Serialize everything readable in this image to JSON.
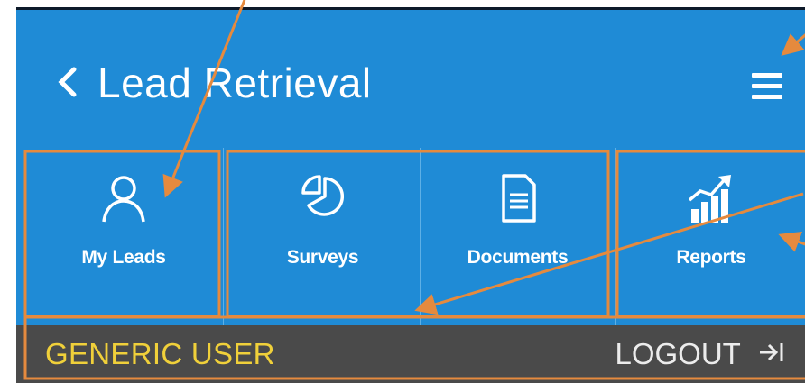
{
  "header": {
    "title": "Lead Retrieval",
    "back_icon": "chevron-left-icon",
    "menu_icon": "hamburger-menu-icon"
  },
  "nav": {
    "items": [
      {
        "label": "My Leads",
        "icon": "person-icon"
      },
      {
        "label": "Surveys",
        "icon": "pie-chart-icon"
      },
      {
        "label": "Documents",
        "icon": "document-icon"
      },
      {
        "label": "Reports",
        "icon": "bar-chart-growth-icon"
      }
    ]
  },
  "status_bar": {
    "user": "GENERIC USER",
    "logout": "LOGOUT",
    "logout_icon": "logout-arrow-icon"
  },
  "colors": {
    "header_blue": "#1f8bd6",
    "status_bg": "#4a4a4a",
    "user_text": "#f0d03a",
    "annotation": "#e58a3e"
  }
}
